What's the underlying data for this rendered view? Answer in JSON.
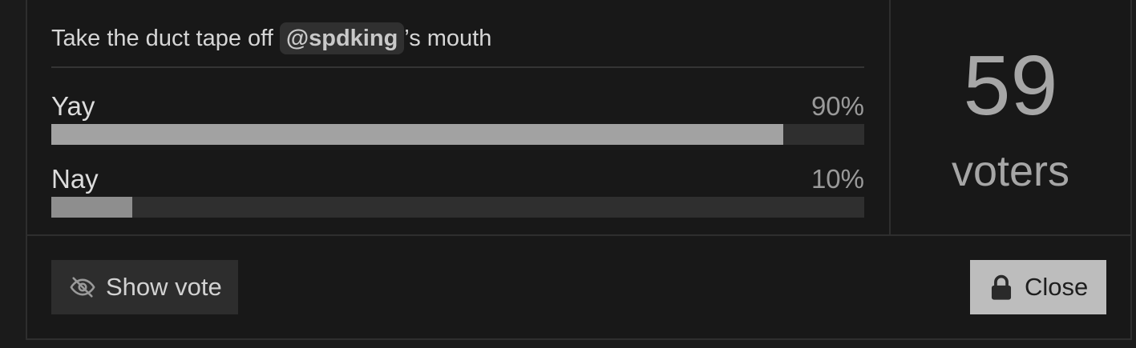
{
  "poll": {
    "title_prefix": "Take the duct tape off ",
    "mention": "@spdking",
    "title_suffix": "’s mouth",
    "options": [
      {
        "label": "Yay",
        "percent_label": "90%",
        "percent": 90
      },
      {
        "label": "Nay",
        "percent_label": "10%",
        "percent": 10
      }
    ],
    "voters": {
      "count": "59",
      "label": "voters"
    }
  },
  "footer": {
    "show_vote_label": "Show vote",
    "show_vote_icon": "eye-slash-icon",
    "close_label": "Close",
    "close_icon": "lock-icon"
  },
  "colors": {
    "background": "#181818",
    "bar_fill": "#a2a2a2",
    "bar_track": "#2f2f2f",
    "close_button": "#bdbdbd",
    "show_vote_button": "#2d2d2d"
  }
}
